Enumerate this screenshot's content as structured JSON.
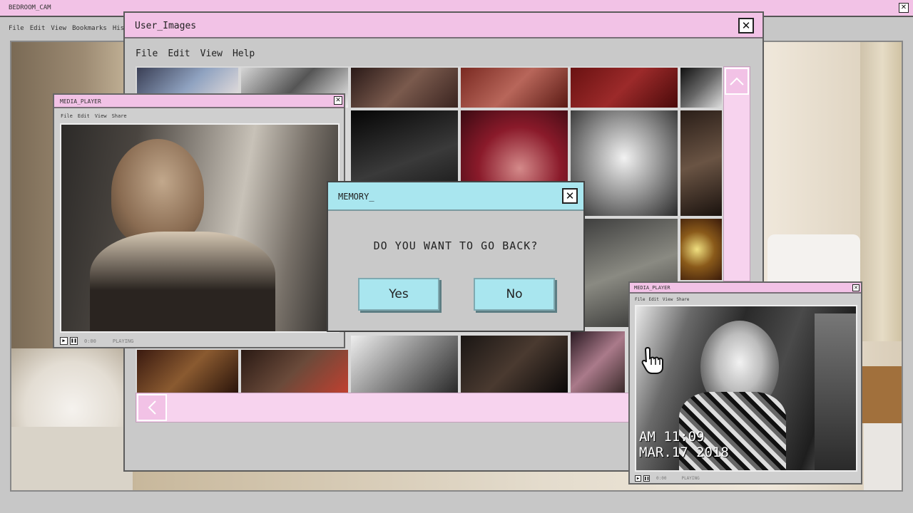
{
  "bedroom": {
    "title": "BEDROOM_CAM",
    "menu": [
      "File",
      "Edit",
      "View",
      "Bookmarks",
      "History"
    ]
  },
  "user_images": {
    "title": "User_Images",
    "menu": [
      "File",
      "Edit",
      "View",
      "Help"
    ]
  },
  "media_left": {
    "title": "MEDIA_PLAYER",
    "menu": [
      "File",
      "Edit",
      "View",
      "Share"
    ],
    "time": "0:00",
    "status": "PLAYING"
  },
  "media_right": {
    "title": "MEDIA_PLAYER",
    "menu": [
      "File",
      "Edit",
      "View",
      "Share"
    ],
    "time": "0:00",
    "status": "PLAYING",
    "stamp_time": "AM 11:09",
    "stamp_date": "MAR.17 2018"
  },
  "dialog": {
    "title": "MEMORY_",
    "question": "DO YOU WANT TO GO BACK?",
    "yes": "Yes",
    "no": "No"
  },
  "colors": {
    "titlebar": "#f2c2e6",
    "dialog_titlebar": "#a9e6ef",
    "button": "#a9e6ef",
    "window_body": "#c9c9c9"
  },
  "icons": {
    "close": "close-icon",
    "up": "chevron-up-icon",
    "left": "chevron-left-icon",
    "cursor": "hand-cursor-icon"
  }
}
